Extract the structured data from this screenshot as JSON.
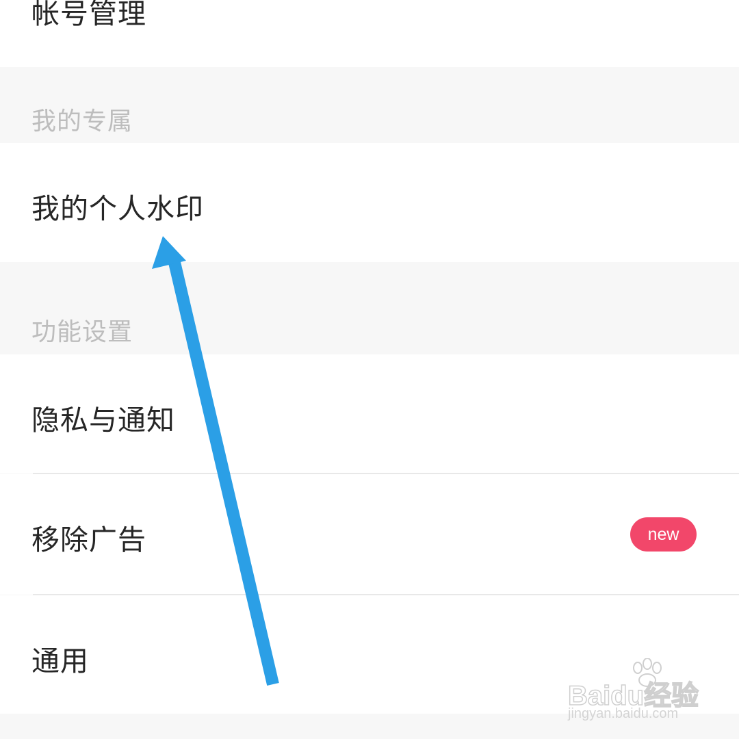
{
  "rows": {
    "account": {
      "label": "帐号管理"
    },
    "watermark": {
      "label": "我的个人水印"
    },
    "privacy": {
      "label": "隐私与通知"
    },
    "remove_ads": {
      "label": "移除广告",
      "badge": "new"
    },
    "general": {
      "label": "通用"
    }
  },
  "sections": {
    "exclusive": {
      "label": "我的专属"
    },
    "features": {
      "label": "功能设置"
    }
  },
  "overlay": {
    "arrow_color": "#2b9fe6",
    "watermark_brand": "Baidu经验",
    "watermark_url": "jingyan.baidu.com"
  },
  "colors": {
    "badge_bg": "#f2476a",
    "page_bg": "#f7f7f7",
    "row_bg": "#ffffff"
  }
}
